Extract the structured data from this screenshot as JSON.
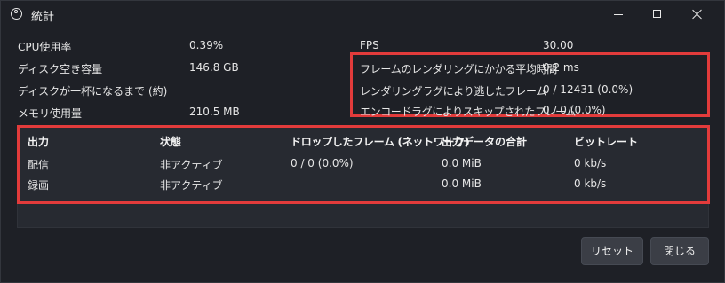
{
  "window": {
    "title": "統計",
    "icon": "obs-logo-icon"
  },
  "stats": {
    "cpu_label": "CPU使用率",
    "cpu_value": "0.39%",
    "disk_label": "ディスク空き容量",
    "disk_value": "146.8 GB",
    "disk_full_label": "ディスクが一杯になるまで (約)",
    "disk_full_value": "",
    "memory_label": "メモリ使用量",
    "memory_value": "210.5 MB",
    "fps_label": "FPS",
    "fps_value": "30.00",
    "render_time_label": "フレームのレンダリングにかかる平均時間",
    "render_time_value": "0.2 ms",
    "render_lag_label": "レンダリングラグにより逃したフレーム",
    "render_lag_value": "0 / 12431 (0.0%)",
    "encode_lag_label": "エンコードラグによりスキップされたフレーム",
    "encode_lag_value": "0 / 0 (0.0%)"
  },
  "outputs": {
    "headers": [
      "出力",
      "状態",
      "ドロップしたフレーム (ネットワーク)",
      "出力データの合計",
      "ビットレート"
    ],
    "rows": [
      [
        "配信",
        "非アクティブ",
        "0 / 0 (0.0%)",
        "0.0 MiB",
        "0 kb/s"
      ],
      [
        "録画",
        "非アクティブ",
        "",
        "0.0 MiB",
        "0 kb/s"
      ]
    ]
  },
  "buttons": {
    "reset": "リセット",
    "close": "閉じる"
  },
  "colors": {
    "highlight": "#e23b3b",
    "background": "#1e2026",
    "panel": "#272a31"
  }
}
